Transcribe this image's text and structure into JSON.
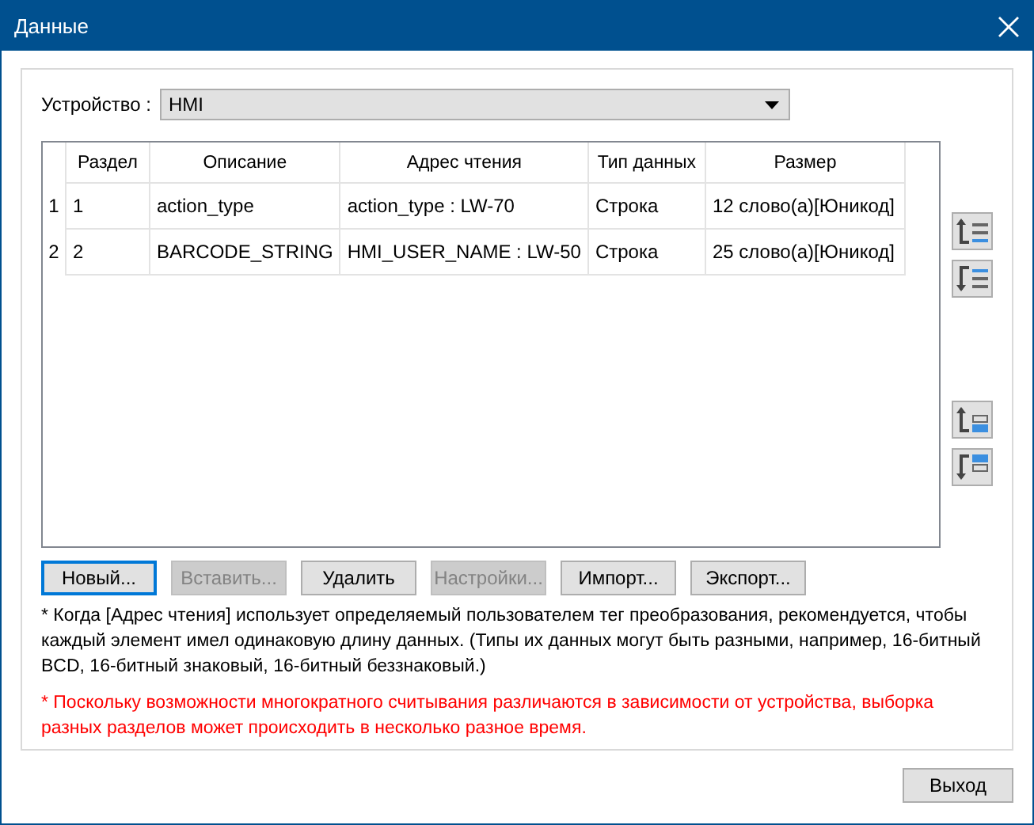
{
  "window": {
    "title": "Данные"
  },
  "device": {
    "label": "Устройство :",
    "value": "HMI"
  },
  "table": {
    "columns": [
      "",
      "Раздел",
      "Описание",
      "Адрес чтения",
      "Тип данных",
      "Размер"
    ],
    "rows": [
      {
        "cells": [
          "1",
          "1",
          "action_type",
          "action_type : LW-70",
          "Строка",
          "12 слово(а)[Юникод]"
        ]
      },
      {
        "cells": [
          "2",
          "2",
          "BARCODE_STRING",
          "HMI_USER_NAME : LW-50",
          "Строка",
          "25 слово(а)[Юникод]"
        ]
      }
    ]
  },
  "side_buttons": [
    {
      "kind": "up-list"
    },
    {
      "kind": "down-list"
    },
    {
      "kind": "up-block"
    },
    {
      "kind": "down-block"
    }
  ],
  "buttons": [
    {
      "label": "Новый...",
      "disabled": false,
      "focused": true
    },
    {
      "label": "Вставить...",
      "disabled": true,
      "focused": false
    },
    {
      "label": "Удалить",
      "disabled": false,
      "focused": false
    },
    {
      "label": "Настройки...",
      "disabled": true,
      "focused": false
    },
    {
      "label": "Импорт...",
      "disabled": false,
      "focused": false
    },
    {
      "label": "Экспорт...",
      "disabled": false,
      "focused": false
    }
  ],
  "notes": [
    {
      "kind": "info",
      "text": "* Когда [Адрес чтения] использует определяемый пользователем тег преобразования, рекомендуется, чтобы каждый элемент имел одинаковую длину данных. (Типы их данных могут быть разными, например, 16-битный BCD, 16-битный знаковый, 16-битный беззнаковый.)"
    },
    {
      "kind": "warning",
      "text": "* Поскольку возможности многократного считывания различаются в зависимости от устройства, выборка разных разделов может происходить в несколько разное время."
    }
  ],
  "exit_button": "Выход"
}
